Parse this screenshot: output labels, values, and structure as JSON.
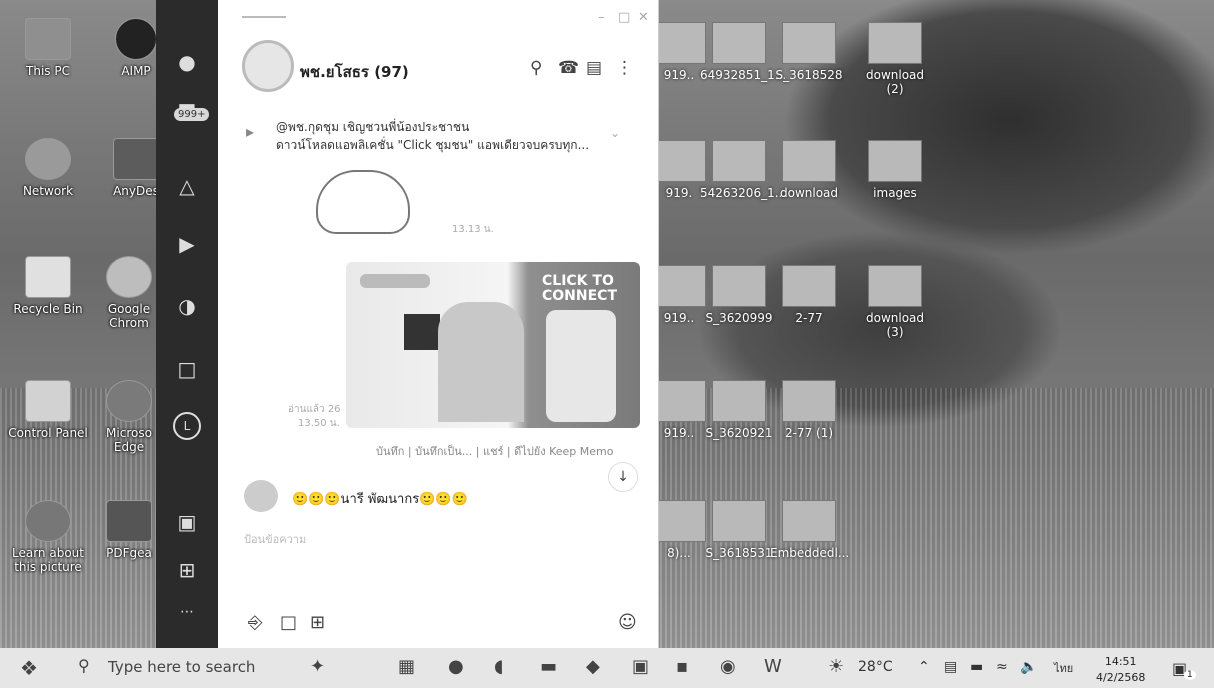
{
  "desktop": {
    "icons_left": [
      {
        "label": "This PC",
        "icon": "pc-icon"
      },
      {
        "label": "AIMP",
        "icon": "aimp-icon"
      },
      {
        "label": "Network",
        "icon": "network-icon"
      },
      {
        "label": "AnyDes",
        "icon": "anydesk-icon"
      },
      {
        "label": "Recycle Bin",
        "icon": "recycle-bin-icon"
      },
      {
        "label": "Google Chrom",
        "icon": "chrome-icon"
      },
      {
        "label": "Control Panel",
        "icon": "control-panel-icon"
      },
      {
        "label": "Microso Edge",
        "icon": "edge-icon"
      },
      {
        "label": "Learn about this picture",
        "icon": "info-icon"
      },
      {
        "label": "PDFgea",
        "icon": "pdf-icon"
      }
    ],
    "thumbs": [
      {
        "label": "919.."
      },
      {
        "label": "64932851_1..."
      },
      {
        "label": "S_3618528"
      },
      {
        "label": "download (2)"
      },
      {
        "label": "919."
      },
      {
        "label": "54263206_1..."
      },
      {
        "label": "download"
      },
      {
        "label": "images"
      },
      {
        "label": "919.."
      },
      {
        "label": "S_3620999"
      },
      {
        "label": "2-77"
      },
      {
        "label": "download (3)"
      },
      {
        "label": "919.."
      },
      {
        "label": "S_3620921"
      },
      {
        "label": "2-77 (1)"
      },
      {
        "label": "8)..."
      },
      {
        "label": "S_3618531"
      },
      {
        "label": "Embeddedl..."
      }
    ]
  },
  "line_rail": {
    "badge": "999+",
    "icons": [
      "person-icon",
      "chat-icon",
      "add-friend-icon",
      "play-icon",
      "pie-icon",
      "square-icon",
      "line-icon",
      "video-icon",
      "crop-icon",
      "more-icon"
    ]
  },
  "chat": {
    "name": "พช.ยโสธร (97)",
    "announcement": {
      "line1": "@พช.กุดชุม  เชิญชวนพี่น้องประชาชน",
      "line2": "ดาวน์โหลดแอพลิเคชั่น \"Click ชุมชน\" แอพเดียวจบครบทุก..."
    },
    "time1": "13.13 น.",
    "banner": {
      "headline": "CLICK TO CONNECT"
    },
    "read_info": "อ่านแล้ว 26",
    "time2": "13.50 น.",
    "meta_line": "บันทึก | บันทึกเป็น... | แชร์ | ดีไปยัง Keep Memo",
    "sender": "🙂🙂🙂นารี พัฒนากร🙂🙂🙂",
    "input_placeholder": "ป้อนข้อความ"
  },
  "taskbar": {
    "search_placeholder": "Type here to search",
    "temperature": "28°C",
    "language": "ไทย",
    "time": "14:51",
    "date": "4/2/2568",
    "notifications": "1"
  }
}
